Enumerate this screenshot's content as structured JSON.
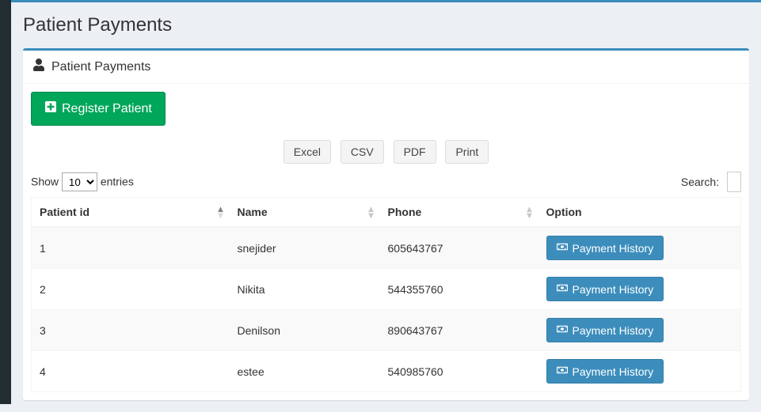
{
  "header": {
    "title": "Patient Payments"
  },
  "panel": {
    "title": "Patient Payments",
    "register_button": "Register Patient"
  },
  "export": {
    "excel": "Excel",
    "csv": "CSV",
    "pdf": "PDF",
    "print": "Print"
  },
  "datatable": {
    "show_label": "Show",
    "entries_label": "entries",
    "page_length": "10",
    "search_label": "Search:",
    "search_value": "",
    "columns": {
      "patient_id": "Patient id",
      "name": "Name",
      "phone": "Phone",
      "option": "Option"
    },
    "row_button": "Payment History",
    "rows": [
      {
        "id": "1",
        "name": "snejider",
        "phone": "605643767"
      },
      {
        "id": "2",
        "name": "Nikita",
        "phone": "544355760"
      },
      {
        "id": "3",
        "name": "Denilson",
        "phone": "890643767"
      },
      {
        "id": "4",
        "name": "estee",
        "phone": "540985760"
      }
    ]
  }
}
